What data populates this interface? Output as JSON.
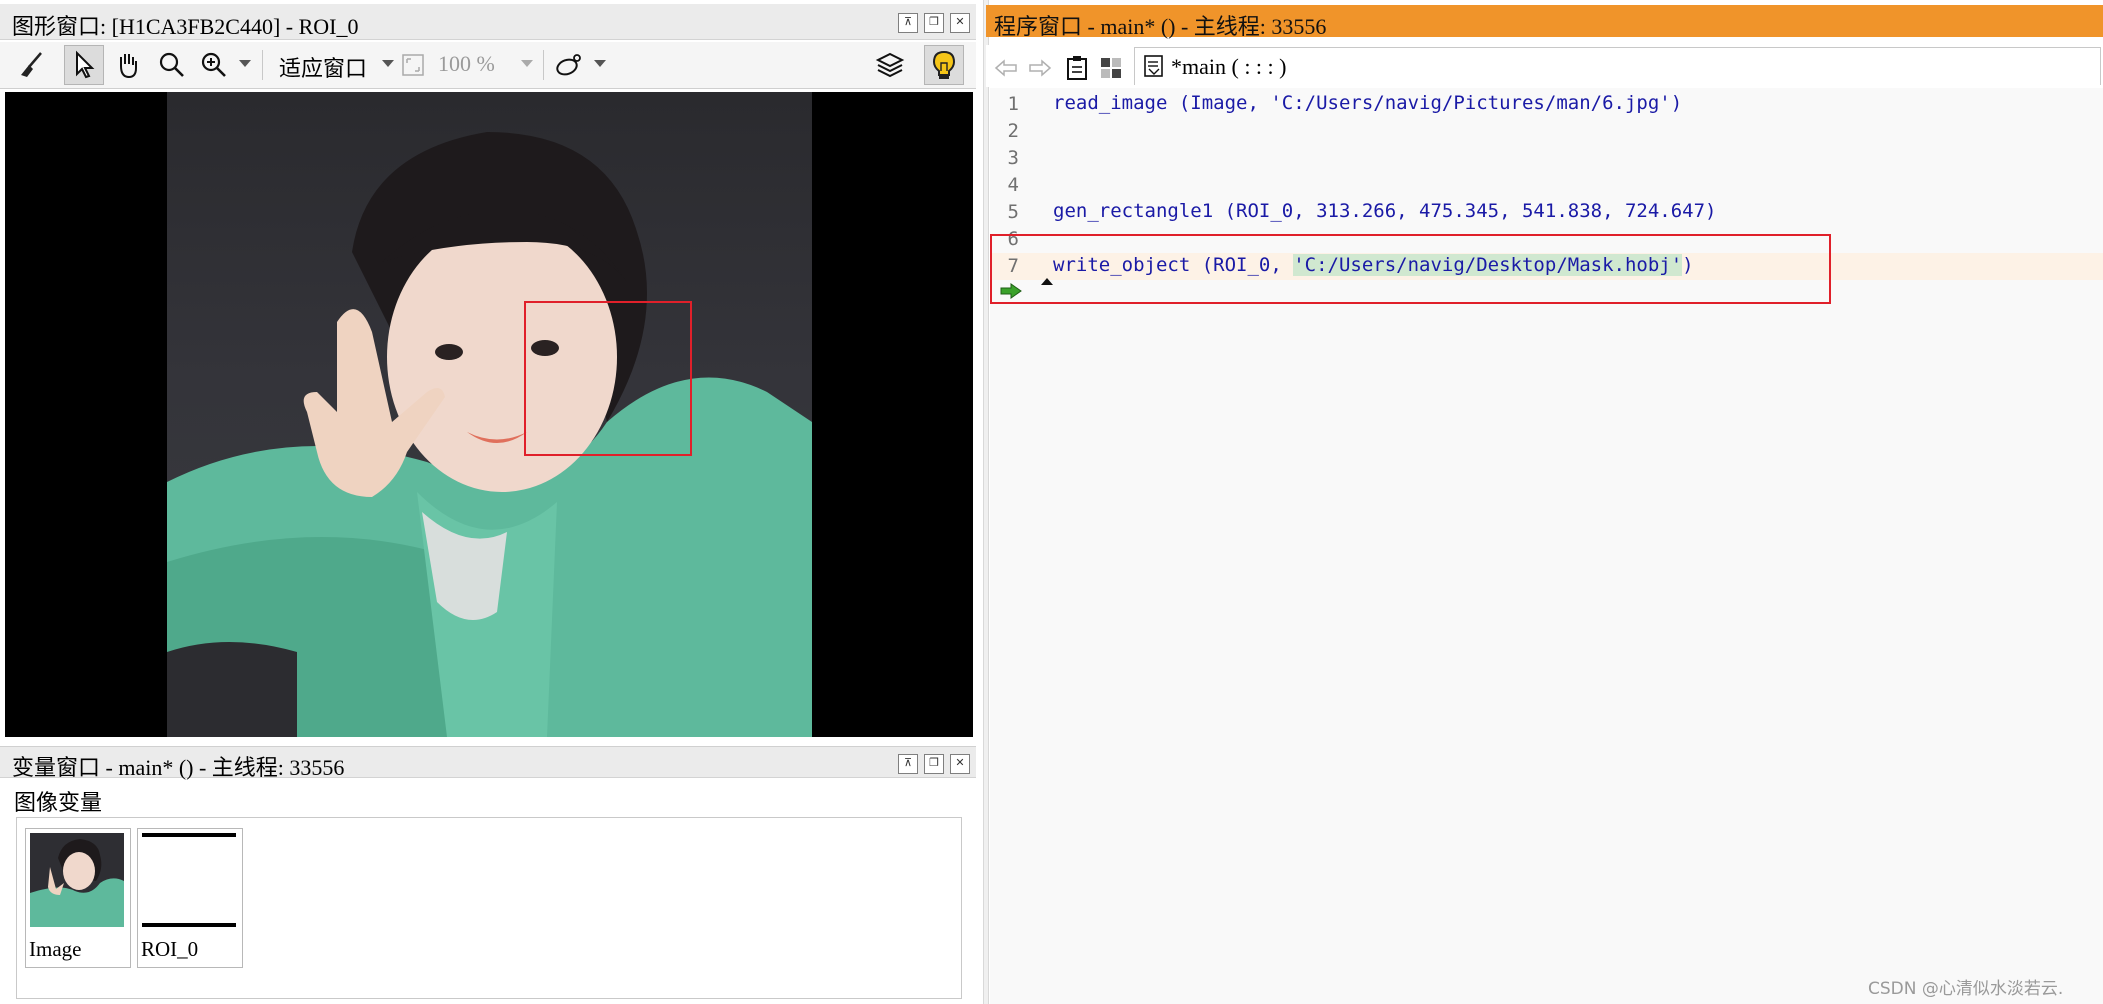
{
  "graphics_window": {
    "title": "图形窗口: [H1CA3FB2C440] - ROI_0",
    "toolbar": {
      "fit_window_label": "适应窗口",
      "zoom_label": "100 %"
    },
    "icons": [
      "broom-icon",
      "pointer-icon",
      "hand-icon",
      "magnifier-icon",
      "zoom-in-icon",
      "fit-window-icon",
      "draw-icon",
      "layers-icon",
      "lightbulb-icon"
    ]
  },
  "variable_window": {
    "title": "变量窗口 - main* () - 主线程: 33556",
    "section_label": "图像变量",
    "variables": [
      {
        "label": "Image"
      },
      {
        "label": "ROI_0"
      }
    ]
  },
  "program_window": {
    "title": "程序窗口 - main* () - 主线程: 33556",
    "tab_label": "*main ( : : : )",
    "lines": [
      {
        "num": "1",
        "code": "read_image (Image, 'C:/Users/navig/Pictures/man/6.jpg')"
      },
      {
        "num": "2",
        "code": ""
      },
      {
        "num": "3",
        "code": ""
      },
      {
        "num": "4",
        "code": ""
      },
      {
        "num": "5",
        "code": "gen_rectangle1 (ROI_0, 313.266, 475.345, 541.838, 724.647)"
      },
      {
        "num": "6",
        "code": ""
      },
      {
        "num": "7",
        "code_pre": "write_object (ROI_0, ",
        "code_hl": "'C:/Users/navig/Desktop/Mask.hobj'",
        "code_post": ")"
      }
    ]
  },
  "watermark": "CSDN @心清似水淡若云."
}
